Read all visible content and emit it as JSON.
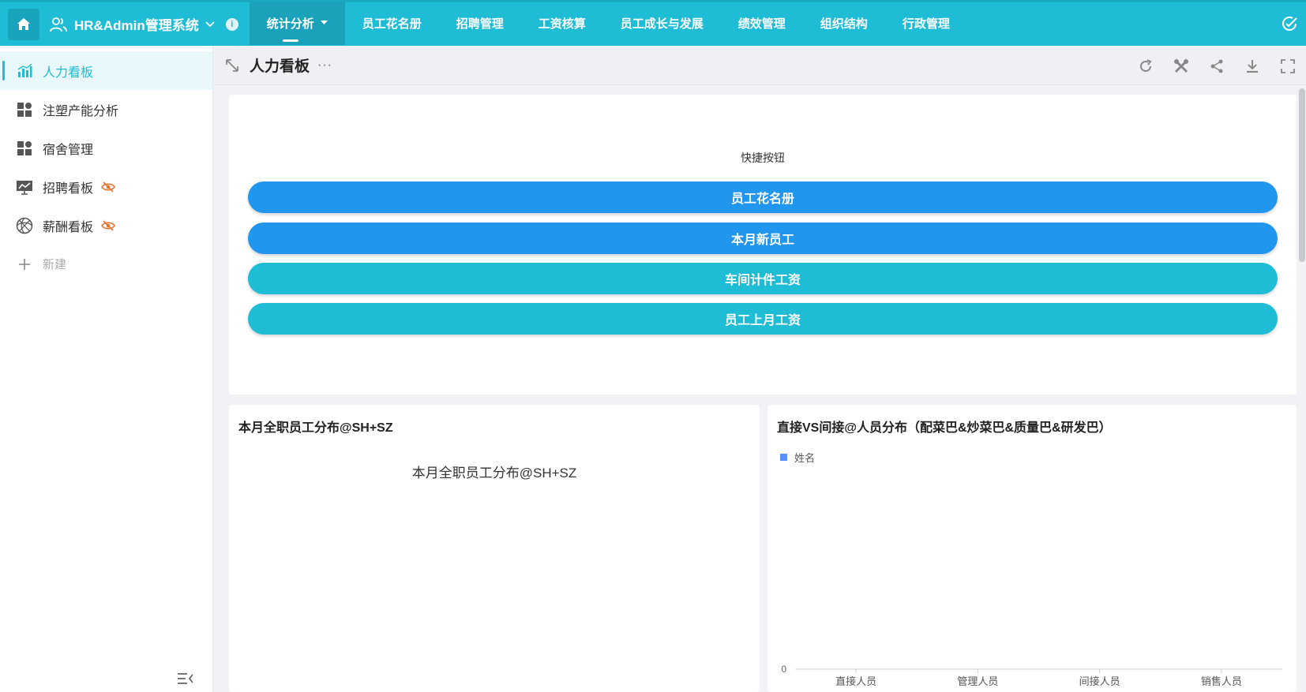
{
  "topbar": {
    "app_title": "HR&Admin管理系统",
    "nav": [
      {
        "label": "统计分析",
        "active": true,
        "has_dropdown": true
      },
      {
        "label": "员工花名册"
      },
      {
        "label": "招聘管理"
      },
      {
        "label": "工资核算"
      },
      {
        "label": "员工成长与发展"
      },
      {
        "label": "绩效管理"
      },
      {
        "label": "组织结构"
      },
      {
        "label": "行政管理"
      }
    ],
    "accent_color": "#1fbcd6"
  },
  "sidebar": {
    "items": [
      {
        "label": "人力看板",
        "icon": "bar-chart-icon",
        "active": true
      },
      {
        "label": "注塑产能分析",
        "icon": "dashboard-icon"
      },
      {
        "label": "宿舍管理",
        "icon": "dashboard-icon"
      },
      {
        "label": "招聘看板",
        "icon": "trend-board-icon",
        "hidden": true
      },
      {
        "label": "薪酬看板",
        "icon": "aperture-icon",
        "hidden": true
      }
    ],
    "new_label": "新建"
  },
  "page": {
    "title": "人力看板",
    "more": "···"
  },
  "shortcuts": {
    "title": "快捷按钮",
    "buttons": [
      {
        "label": "员工花名册",
        "color": "#2196ee"
      },
      {
        "label": "本月新员工",
        "color": "#2196ee"
      },
      {
        "label": "车间计件工资",
        "color": "#1fbcd6"
      },
      {
        "label": "员工上月工资",
        "color": "#1fbcd6"
      }
    ]
  },
  "left_chart": {
    "title": "本月全职员工分布@SH+SZ",
    "subtitle": "本月全职员工分布@SH+SZ"
  },
  "right_chart": {
    "title": "直接VS间接@人员分布（配菜巴&炒菜巴&质量巴&研发巴）"
  },
  "chart_data": {
    "type": "bar",
    "title": "直接VS间接@人员分布（配菜巴&炒菜巴&质量巴&研发巴）",
    "categories": [
      "直接人员",
      "管理人员",
      "间接人员",
      "销售人员"
    ],
    "series": [
      {
        "name": "姓名",
        "values": [
          0,
          0,
          0,
          0
        ],
        "color": "#5b8ff9"
      }
    ],
    "y_ticks": [
      "0"
    ],
    "legend": "top-left",
    "grid": false
  }
}
